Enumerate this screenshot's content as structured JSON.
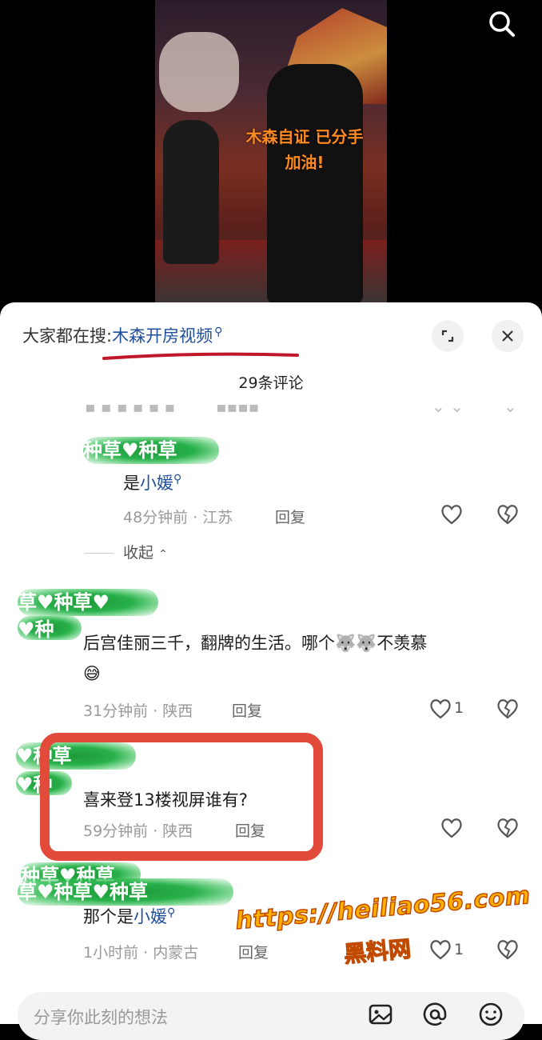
{
  "video": {
    "caption_line1": "木森自证 已分手",
    "caption_line2": "加油!"
  },
  "sheet": {
    "search_prefix": "大家都在搜:",
    "search_term": "木森开房视频",
    "comment_count": "29条评论",
    "collapse_label": "收起",
    "input_placeholder": "分享你此刻的想法"
  },
  "comments": [
    {
      "name": "种草♥种草",
      "text_prefix": "是",
      "text_link": "小媛",
      "time_location": "48分钟前 · 江苏",
      "reply": "回复",
      "likes": ""
    },
    {
      "name": "草♥种草♥",
      "name2": "♥种",
      "text": "后宫佳丽三千，翻牌的生活。哪个🐺🐺不羡慕",
      "text2": "😅",
      "time_location": "31分钟前 · 陕西",
      "reply": "回复",
      "likes": "1"
    },
    {
      "name": "♥种草",
      "name2": "♥种",
      "text": "喜来登13楼视屏谁有?",
      "time_location": "59分钟前 · 陕西",
      "reply": "回复",
      "likes": ""
    },
    {
      "name": "种草♥种草",
      "name2": "草♥种草♥种草",
      "text_prefix": "那个是",
      "text_link": "小媛",
      "time_location": "1小时前 · 内蒙古",
      "reply": "回复",
      "likes": "1"
    }
  ],
  "watermark": {
    "url": "https://heiliao56.com",
    "name": "黑料网"
  },
  "colors": {
    "link": "#1f4f9a",
    "highlight": "#e24a3c",
    "blur_green": "#27b04a",
    "watermark": "#ffb000"
  }
}
